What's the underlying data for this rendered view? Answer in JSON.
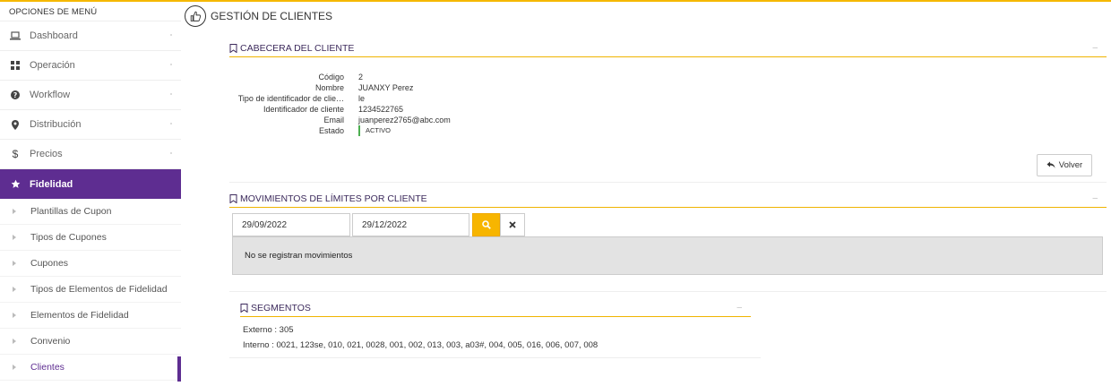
{
  "sidebar": {
    "title": "OPCIONES DE MENÚ",
    "items": [
      {
        "label": "Dashboard",
        "icon": "laptop-icon"
      },
      {
        "label": "Operación",
        "icon": "grid-icon"
      },
      {
        "label": "Workflow",
        "icon": "question-circle-icon"
      },
      {
        "label": "Distribución",
        "icon": "map-pin-icon"
      },
      {
        "label": "Precios",
        "icon": "dollar-icon"
      }
    ],
    "active": {
      "label": "Fidelidad",
      "icon": "star-icon"
    },
    "subitems": [
      "Plantillas de Cupon",
      "Tipos de Cupones",
      "Cupones",
      "Tipos de Elementos de Fidelidad",
      "Elementos de Fidelidad",
      "Convenio",
      "Clientes"
    ]
  },
  "header": {
    "title": "GESTIÓN DE CLIENTES",
    "icon": "thumbs-up-icon"
  },
  "cabecera": {
    "title": "CABECERA DEL CLIENTE",
    "fields": [
      {
        "label": "Código",
        "value": "2"
      },
      {
        "label": "Nombre",
        "value": "JUANXY Perez"
      },
      {
        "label": "Tipo de identificador de clie…",
        "value": "le"
      },
      {
        "label": "Identificador de cliente",
        "value": "1234522765"
      },
      {
        "label": "Email",
        "value": "juanperez2765@abc.com"
      }
    ],
    "estado_label": "Estado",
    "estado_value": "ACTIVO",
    "volver_label": "Volver"
  },
  "movimientos": {
    "title": "MOVIMIENTOS DE LÍMITES POR CLIENTE",
    "date_from": "29/09/2022",
    "date_to": "29/12/2022",
    "empty_text": "No se registran movimientos"
  },
  "segmentos": {
    "title": "SEGMENTOS",
    "externo": "Externo : 305",
    "interno": "Interno : 0021, 123se, 010, 021, 0028, 001, 002, 013, 003, a03#, 004, 005, 016, 006, 007, 008"
  },
  "colors": {
    "accent": "#f5b800",
    "brand": "#5e2d91",
    "status_active": "#4caf50"
  }
}
